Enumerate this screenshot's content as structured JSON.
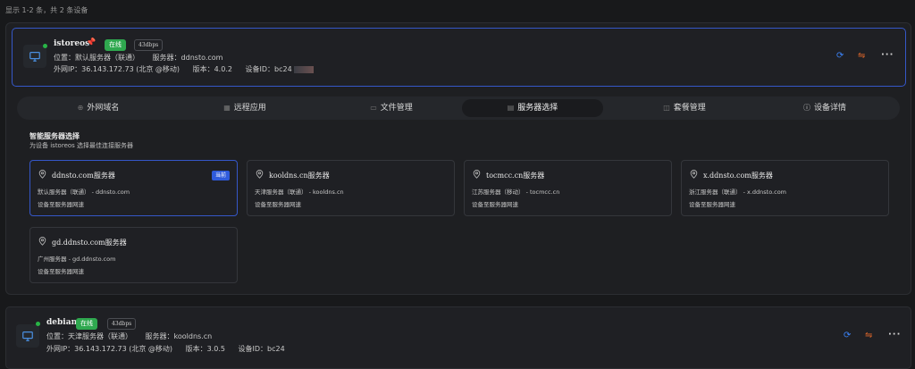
{
  "summary": "显示 1-2 条，共 2 条设备",
  "devices": [
    {
      "name": "istoreos",
      "status": "在线",
      "speed": "43dbps",
      "location_label": "位置：默认服务器（联通）",
      "server_label": "服务器：ddnsto.com",
      "ip_label": "外网IP：36.143.172.73 (北京 @移动)",
      "version_label": "版本：4.0.2",
      "device_id_label": "设备ID：bc24"
    },
    {
      "name": "debian",
      "status": "在线",
      "speed": "43dbps",
      "location_label": "位置：天津服务器（联通）",
      "server_label": "服务器：kooldns.cn",
      "ip_label": "外网IP：36.143.172.73 (北京 @移动)",
      "version_label": "版本：3.0.5",
      "device_id_label": "设备ID：bc24"
    }
  ],
  "tabs": [
    {
      "label": "外网域名"
    },
    {
      "label": "远程应用"
    },
    {
      "label": "文件管理"
    },
    {
      "label": "服务器选择"
    },
    {
      "label": "套餐管理"
    },
    {
      "label": "设备详情"
    }
  ],
  "server_section": {
    "title": "智能服务器选择",
    "subtitle": "为设备 istoreos 选择最佳连接服务器",
    "current_badge": "当前",
    "servers": [
      {
        "name": "ddnsto.com服务器",
        "location": "默认服务器（联通） - ddnsto.com",
        "test": "设备至服务器网速"
      },
      {
        "name": "kooldns.cn服务器",
        "location": "天津服务器（联通） - kooldns.cn",
        "test": "设备至服务器网速"
      },
      {
        "name": "tocmcc.cn服务器",
        "location": "江苏服务器（移动） - tocmcc.cn",
        "test": "设备至服务器网速"
      },
      {
        "name": "x.ddnsto.com服务器",
        "location": "浙江服务器（联通） - x.ddnsto.com",
        "test": "设备至服务器网速"
      },
      {
        "name": "gd.ddnsto.com服务器",
        "location": "广州服务器 - gd.ddnsto.com",
        "test": "设备至服务器网速"
      }
    ]
  },
  "icons": {
    "device": "monitor-icon",
    "pin": "pushpin-icon",
    "refresh": "refresh-icon",
    "switch": "switch-icon",
    "more": "more-icon",
    "location": "map-pin-icon"
  },
  "colors": {
    "accent": "#3557c8",
    "online": "#2fa84f",
    "warning": "#e0672a",
    "refresh": "#3b82f6"
  }
}
